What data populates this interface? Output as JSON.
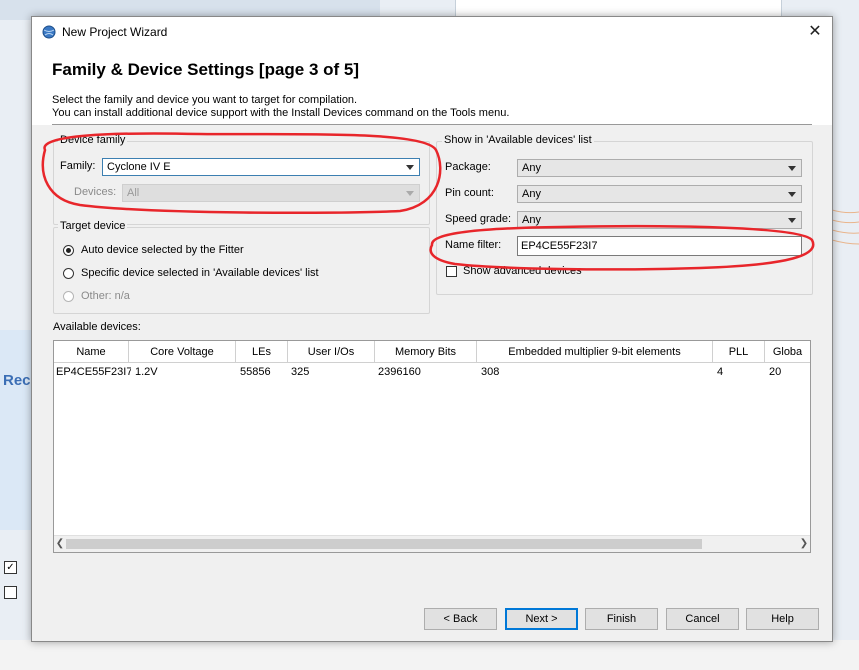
{
  "background": {
    "left_text": "Rec",
    "check_1": "✓"
  },
  "window": {
    "title": "New Project Wizard",
    "close_glyph": "✕"
  },
  "header": {
    "title": "Family & Device Settings [page 3 of 5]",
    "description_line1": "Select the family and device you want to target for compilation.",
    "description_line2": "You can install additional device support with the Install Devices command on the Tools menu."
  },
  "device_family": {
    "group_label": "Device family",
    "family_label": "Family:",
    "family_value": "Cyclone IV E",
    "devices_label": "Devices:",
    "devices_value": "All"
  },
  "target_device": {
    "group_label": "Target device",
    "options": [
      {
        "label": "Auto device selected by the Fitter",
        "checked": true,
        "enabled": true
      },
      {
        "label": "Specific device selected in 'Available devices' list",
        "checked": false,
        "enabled": true
      },
      {
        "label": "Other:  n/a",
        "checked": false,
        "enabled": false
      }
    ]
  },
  "show_in_list": {
    "group_label": "Show in 'Available devices' list",
    "package_label": "Package:",
    "package_value": "Any",
    "pin_count_label": "Pin count:",
    "pin_count_value": "Any",
    "speed_grade_label": "Speed grade:",
    "speed_grade_value": "Any",
    "name_filter_label": "Name filter:",
    "name_filter_value": "EP4CE55F23I7",
    "show_advanced_label": "Show advanced devices"
  },
  "available_devices": {
    "label": "Available devices:",
    "columns": [
      "Name",
      "Core Voltage",
      "LEs",
      "User I/Os",
      "Memory Bits",
      "Embedded multiplier 9-bit elements",
      "PLL",
      "Globa"
    ],
    "rows": [
      [
        "EP4CE55F23I7",
        "1.2V",
        "55856",
        "325",
        "2396160",
        "308",
        "4",
        "20"
      ]
    ]
  },
  "buttons": {
    "back": "< Back",
    "next": "Next >",
    "finish": "Finish",
    "cancel": "Cancel",
    "help": "Help"
  },
  "colors": {
    "highlight_annotation": "#e8262b",
    "selected_row": "#ffffff",
    "focus_border": "#0078d7"
  }
}
